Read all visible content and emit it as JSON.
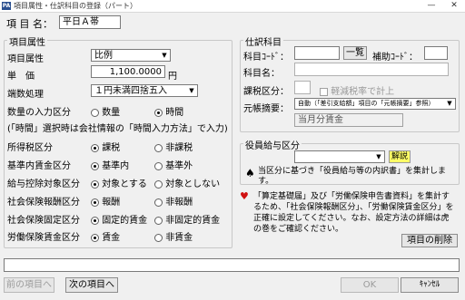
{
  "window": {
    "title": "項目属性・仕訳科目の登録（パート）",
    "app_icon": "PA",
    "minimize_icon": "—",
    "close_icon": "✕"
  },
  "item_name": {
    "label": "項 目 名：",
    "value": "平日Ａ帯"
  },
  "attributes": {
    "group_title": "項目属性",
    "attr_label": "項目属性",
    "attr_value": "比例",
    "price_label": "単　価",
    "price_value": "1,100.0000",
    "price_unit": "円",
    "rounding_label": "端数処理",
    "rounding_value": "１円未満四捨五入",
    "qty_label": "数量の入力区分",
    "qty_options": [
      "数量",
      "時間"
    ],
    "qty_note": "(「時間」選択時は会社情報の「時間入力方法」で入力)",
    "tax_label": "所得税区分",
    "tax_options": [
      "課税",
      "非課税"
    ],
    "base_label": "基準内賃金区分",
    "base_options": [
      "基準内",
      "基準外"
    ],
    "deduct_label": "給与控除対象区分",
    "deduct_options": [
      "対象とする",
      "対象としない"
    ],
    "social_label": "社会保険報酬区分",
    "social_options": [
      "報酬",
      "非報酬"
    ],
    "employ_label": "社会保険固定区分",
    "employ_options": [
      "固定的賃金",
      "非固定的賃金"
    ],
    "labor_label": "労働保険賃金区分",
    "labor_options": [
      "賃金",
      "非賃金"
    ]
  },
  "journal": {
    "group_title": "仕訳科目",
    "code_label": "科目ｺｰﾄﾞ：",
    "list_button": "一覧",
    "sub_code_label": "補助ｺｰﾄﾞ：",
    "name_label": "科目名：",
    "tax_class_label": "課税区分：",
    "reduced_rate_label": "軽減税率で計上",
    "summary_label": "元帳摘要：",
    "summary_value": "自動（「差引支給額」項目の「元帳摘要」参照）",
    "month_summary": "当月分賃金"
  },
  "officer": {
    "group_title": "役員給与区分",
    "explain_button": "解説",
    "note": "当区分に基づき「役員給与等の内訳書」を集計します。",
    "spade_icon": "♠"
  },
  "notice": {
    "heart_icon": "♥",
    "text": "「算定基礎届」及び「労働保険申告書資料」を集計するため、「社会保険報酬区分」、「労働保険賃金区分」を正確に設定してください。なお、設定方法の詳細は虎の巻をご確認ください。"
  },
  "footer": {
    "delete_button": "項目の削除",
    "prev_button": "前の項目へ",
    "next_button": "次の項目へ",
    "ok_button": "OK",
    "cancel_button": "ｷｬﾝｾﾙ"
  }
}
